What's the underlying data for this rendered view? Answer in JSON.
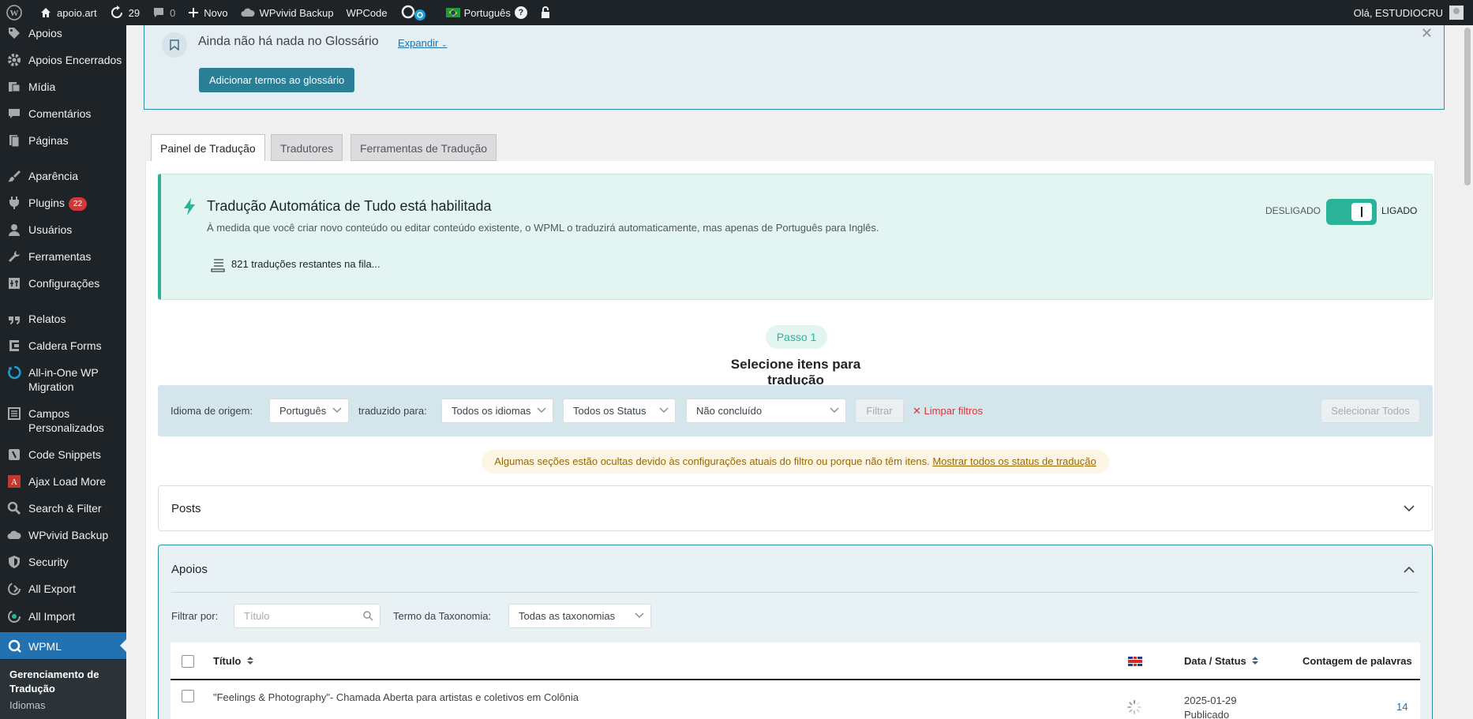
{
  "adminbar": {
    "site_name": "apoio.art",
    "updates_count": "29",
    "comments_count": "0",
    "new_label": "Novo",
    "wpvivid_label": "WPvivid Backup",
    "wpcode_label": "WPCode",
    "language_label": "Português",
    "greeting": "Olá, ESTUDIOCRU"
  },
  "sidebar": {
    "items": [
      {
        "label": "Apoios"
      },
      {
        "label": "Apoios Encerrados"
      },
      {
        "label": "Mídia"
      },
      {
        "label": "Comentários"
      },
      {
        "label": "Páginas"
      },
      {
        "label": "Aparência"
      },
      {
        "label": "Plugins",
        "badge": "22"
      },
      {
        "label": "Usuários"
      },
      {
        "label": "Ferramentas"
      },
      {
        "label": "Configurações"
      },
      {
        "label": "Relatos"
      },
      {
        "label": "Caldera Forms"
      },
      {
        "label": "All-in-One WP Migration"
      },
      {
        "label": "Campos Personalizados"
      },
      {
        "label": "Code Snippets"
      },
      {
        "label": "Ajax Load More"
      },
      {
        "label": "Search & Filter"
      },
      {
        "label": "WPvivid Backup"
      },
      {
        "label": "Security"
      },
      {
        "label": "All Export"
      },
      {
        "label": "All Import"
      },
      {
        "label": "WPML"
      }
    ],
    "submenu": {
      "current": "Gerenciamento de Tradução",
      "next": "Idiomas"
    }
  },
  "glossary": {
    "title": "Ainda não há nada no Glossário",
    "expand": "Expandir",
    "add_button": "Adicionar termos ao glossário"
  },
  "tabs": [
    {
      "label": "Painel de Tradução"
    },
    {
      "label": "Tradutores"
    },
    {
      "label": "Ferramentas de Tradução"
    }
  ],
  "auto": {
    "title": "Tradução Automática de Tudo está habilitada",
    "description": "À medida que você criar novo conteúdo ou editar conteúdo existente, o WPML o traduzirá automaticamente, mas apenas de Português para Inglês.",
    "queue": "821 traduções restantes na fila...",
    "off_label": "DESLIGADO",
    "on_label": "LIGADO"
  },
  "step": {
    "pill": "Passo 1",
    "title": "Selecione itens para tradução"
  },
  "filters": {
    "source_label": "Idioma de origem:",
    "source_value": "Português",
    "to_label": "traduzido para:",
    "to_value": "Todos os idiomas",
    "status_value": "Todos os Status",
    "completion_value": "Não concluído",
    "filter_button": "Filtrar",
    "clear_button": "Limpar filtros",
    "select_all": "Selecionar Todos"
  },
  "notice": {
    "text": "Algumas seções estão ocultas devido às configurações atuais do filtro ou porque não têm itens.",
    "link": "Mostrar todos os status de tradução"
  },
  "sections": {
    "posts_title": "Posts",
    "apoios_title": "Apoios",
    "filter_by_label": "Filtrar por:",
    "title_placeholder": "Título",
    "taxonomy_label": "Termo da Taxonomia:",
    "taxonomy_value": "Todas as taxonomias"
  },
  "table": {
    "headers": {
      "title": "Título",
      "date_status": "Data / Status",
      "word_count": "Contagem de palavras"
    },
    "rows": [
      {
        "title": "\"Feelings & Photography\"- Chamada Aberta para artistas e coletivos em Colônia",
        "date": "2025-01-29",
        "status": "Publicado",
        "words": "14"
      }
    ]
  }
}
